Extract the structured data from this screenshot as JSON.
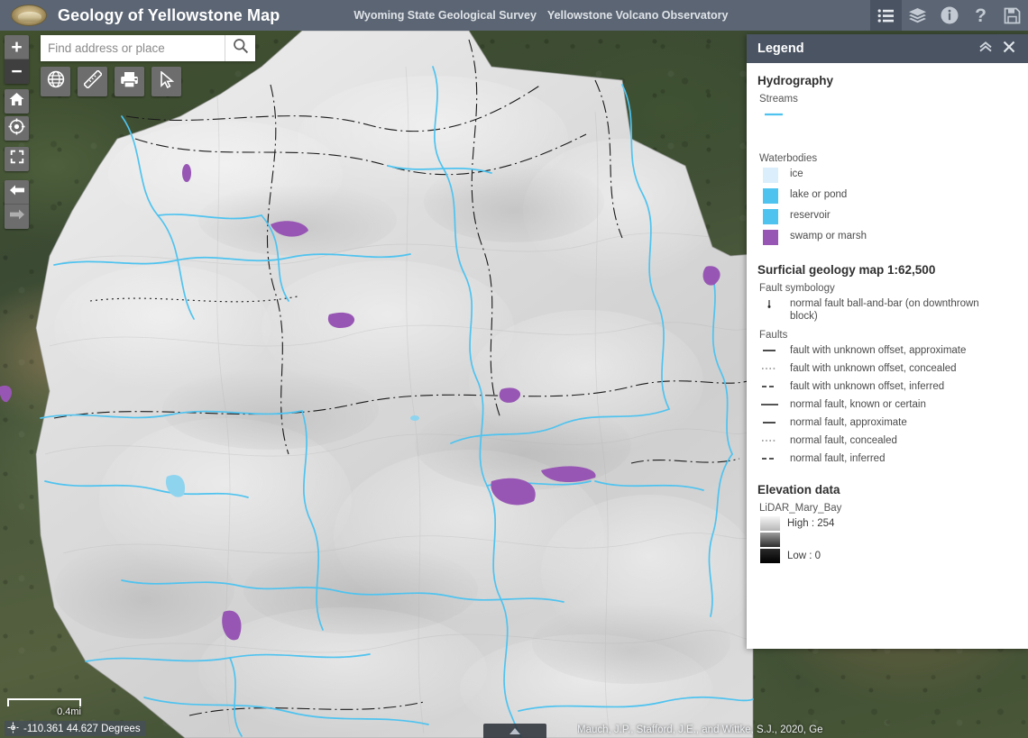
{
  "header": {
    "app_title": "Geology of Yellowstone Map",
    "logo_icon": "agency-seal-logo",
    "links": [
      {
        "label": "Wyoming State Geological Survey",
        "name": "header-link-wsgs"
      },
      {
        "label": "Yellowstone Volcano Observatory",
        "name": "header-link-yvo"
      }
    ],
    "tools": [
      {
        "name": "legend-tool",
        "icon": "legend-list-icon",
        "active": true
      },
      {
        "name": "layers-tool",
        "icon": "layers-stack-icon",
        "active": false
      },
      {
        "name": "about-tool",
        "icon": "info-circle-icon",
        "active": false
      },
      {
        "name": "help-tool",
        "icon": "question-mark-icon",
        "active": false
      },
      {
        "name": "save-tool",
        "icon": "floppy-save-icon",
        "active": false
      }
    ]
  },
  "map_controls": {
    "zoom_in": {
      "label": "+",
      "name": "zoom-in-button"
    },
    "zoom_out": {
      "label": "−",
      "name": "zoom-out-button"
    },
    "home": {
      "icon": "home-icon",
      "name": "default-extent-button"
    },
    "locate": {
      "icon": "crosshair-target-icon",
      "name": "my-location-button"
    },
    "fullscreen": {
      "icon": "fullscreen-corners-icon",
      "name": "full-extent-button"
    },
    "prev_extent": {
      "icon": "arrow-left-icon",
      "name": "previous-extent-button"
    },
    "next_extent": {
      "icon": "arrow-right-icon",
      "name": "next-extent-button"
    }
  },
  "search": {
    "placeholder": "Find address or place",
    "value": "",
    "button_icon": "magnifier-icon"
  },
  "map_tools": [
    {
      "name": "basemap-gallery-button",
      "icon": "globe-icon"
    },
    {
      "name": "measure-button",
      "icon": "ruler-icon"
    },
    {
      "name": "print-button",
      "icon": "printer-icon"
    },
    {
      "name": "select-button",
      "icon": "cursor-arrow-icon"
    }
  ],
  "map_footer": {
    "scale_label": "0.4mi",
    "coordinates": "-110.361 44.627 Degrees",
    "coord_icon": "crosshair-small-icon",
    "attribution": "Mauch, J.P., Stafford, J.E., and Wittke, S.J., 2020, Ge",
    "overview_toggle_icon": "triangle-up-icon"
  },
  "legend": {
    "title": "Legend",
    "collapse_icon": "double-chevron-up-icon",
    "close_icon": "close-x-icon",
    "sections": [
      {
        "name": "hydrography",
        "title": "Hydrography",
        "subsections": [
          {
            "label": "Streams",
            "items": [
              {
                "type": "line",
                "style": "solid",
                "color": "#4fc3ef",
                "width": 2,
                "label": ""
              }
            ]
          },
          {
            "label": "Waterbodies",
            "items": [
              {
                "type": "chip",
                "color": "#daeefb",
                "label": "ice"
              },
              {
                "type": "chip",
                "color": "#4fc3ef",
                "label": "lake or pond"
              },
              {
                "type": "chip",
                "color": "#4fc3ef",
                "label": "reservoir"
              },
              {
                "type": "chip",
                "color": "#9756b4",
                "label": "swamp or marsh"
              }
            ]
          }
        ]
      },
      {
        "name": "surficial-geology",
        "title": "Surficial geology map 1:62,500",
        "subsections": [
          {
            "label": "Fault symbology",
            "items": [
              {
                "type": "balldash",
                "color": "#2b2b2b",
                "label": "normal fault ball-and-bar (on downthrown block)"
              }
            ]
          },
          {
            "label": "Faults",
            "items": [
              {
                "type": "line",
                "style": "solid",
                "color": "#4b4b4b",
                "width": 2,
                "label": "fault with unknown offset, approximate"
              },
              {
                "type": "line",
                "style": "dotted",
                "color": "#8a8a8a",
                "width": 1,
                "label": "fault with unknown offset, concealed"
              },
              {
                "type": "line",
                "style": "dashed",
                "color": "#3c3c3c",
                "width": 2,
                "label": "fault with unknown offset, inferred"
              },
              {
                "type": "line",
                "style": "solid",
                "color": "#1d1d1d",
                "width": 1.5,
                "label": "normal fault, known or certain"
              },
              {
                "type": "line",
                "style": "solid",
                "color": "#4b4b4b",
                "width": 2,
                "label": "normal fault, approximate"
              },
              {
                "type": "line",
                "style": "dotted",
                "color": "#8a8a8a",
                "width": 1,
                "label": "normal fault, concealed"
              },
              {
                "type": "line",
                "style": "dashed",
                "color": "#3c3c3c",
                "width": 2,
                "label": "normal fault, inferred"
              }
            ]
          }
        ]
      },
      {
        "name": "elevation-data",
        "title": "Elevation data",
        "subsections": [
          {
            "label": "LiDAR_Mary_Bay",
            "ramp": [
              {
                "from": "#f4f4f4",
                "to": "#b9b9b9",
                "label": "High : 254"
              },
              {
                "from": "#9a9a9a",
                "to": "#2e2e2e",
                "label": ""
              },
              {
                "from": "#2a2a2a",
                "to": "#000000",
                "label": "Low : 0"
              }
            ]
          }
        ]
      }
    ]
  },
  "colors": {
    "header_bg": "#5b6573",
    "panel_header_bg": "#4a5463",
    "stream_blue": "#4fc3ef",
    "marsh_purple": "#9756b4",
    "control_gray": "#6d6d6d"
  }
}
